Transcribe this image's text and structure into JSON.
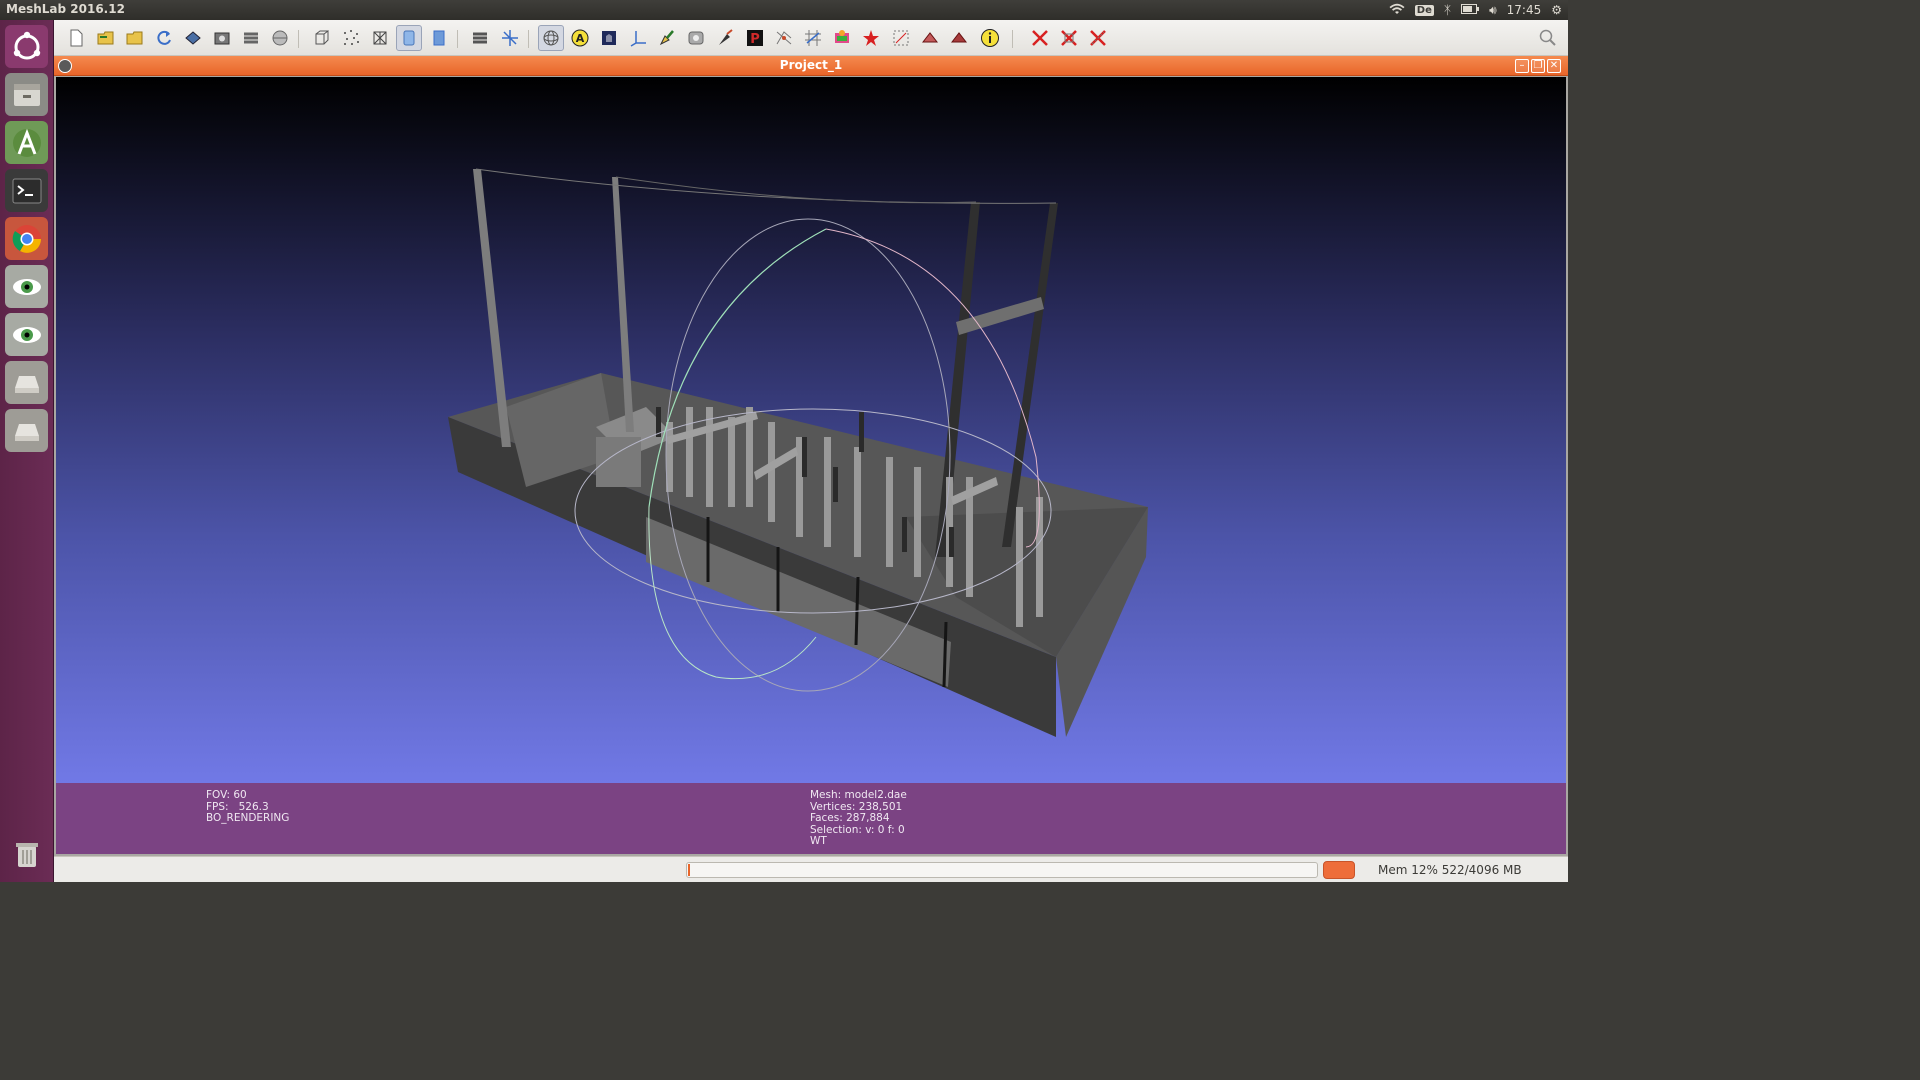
{
  "topbar": {
    "app_title": "MeshLab 2016.12",
    "keyboard_layout": "De",
    "clock": "17:45"
  },
  "launcher": {
    "items": [
      {
        "name": "ubuntu-dash-icon"
      },
      {
        "name": "files-icon"
      },
      {
        "name": "android-studio-icon"
      },
      {
        "name": "terminal-icon"
      },
      {
        "name": "chrome-icon"
      },
      {
        "name": "eye-of-gnome-icon"
      },
      {
        "name": "eye-of-gnome-icon"
      },
      {
        "name": "drive-icon"
      },
      {
        "name": "drive-icon"
      },
      {
        "name": "trash-icon"
      }
    ]
  },
  "toolbar": {
    "icons": [
      "new-project-icon",
      "open-project-icon",
      "open-mesh-icon",
      "reload-icon",
      "save-snapshot-icon",
      "screenshot-icon",
      "layers-icon",
      "lights-icon",
      "bounding-box-icon",
      "points-icon",
      "wireframe-icon",
      "smooth-icon",
      "flat-icon",
      "decorations-icon",
      "axes-icon",
      "trackball-icon",
      "annotation-icon",
      "quality-icon",
      "normals-icon",
      "paint-icon",
      "brush-icon",
      "pick-points-icon",
      "align-icon",
      "measure-icon",
      "color-icon",
      "georef-icon",
      "select-vertices-icon",
      "select-faces-icon",
      "select-connected-icon",
      "info-icon",
      "delete-vertices-icon",
      "delete-faces-icon",
      "delete-selection-icon"
    ],
    "search_icon": "search-icon"
  },
  "window": {
    "title": "Project_1"
  },
  "info": {
    "left": [
      "FOV: 60",
      "FPS:   526.3",
      "BO_RENDERING"
    ],
    "right": [
      "Mesh: model2.dae",
      "Vertices: 238,501",
      "Faces: 287,884",
      "Selection: v: 0 f: 0",
      "WT"
    ]
  },
  "status": {
    "memory": "Mem 12% 522/4096 MB",
    "memory_fraction": 0.12,
    "progress_fraction": 0.0
  },
  "colors": {
    "accent": "#e8652a",
    "launcher": "#6b2c55",
    "info_panel": "#7b4383"
  }
}
